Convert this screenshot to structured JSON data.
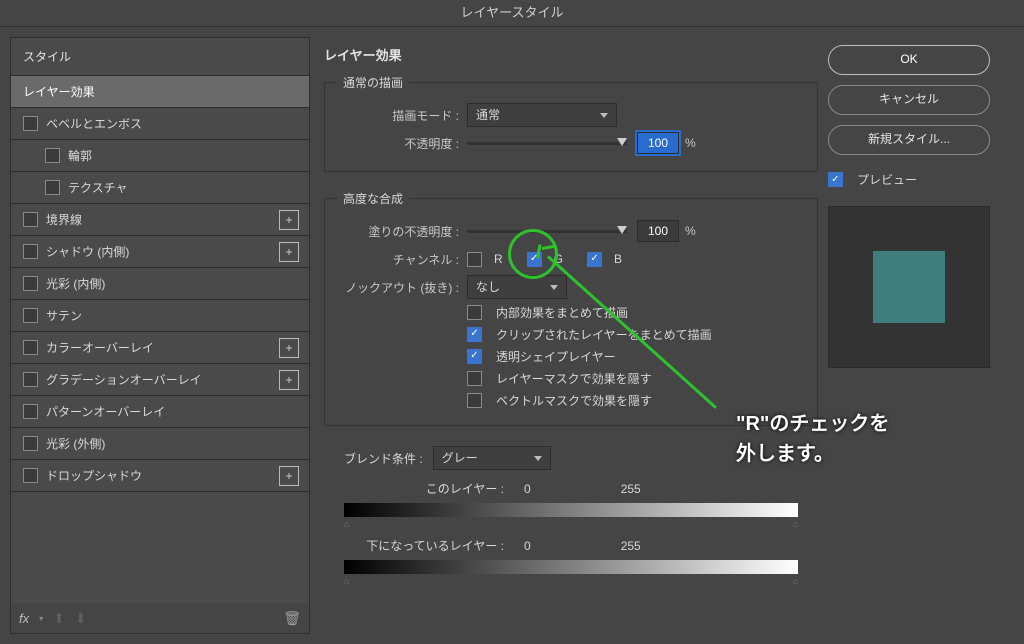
{
  "window": {
    "title": "レイヤースタイル"
  },
  "sidebar": {
    "header": "スタイル",
    "items": [
      {
        "label": "レイヤー効果",
        "selected": true,
        "check": false,
        "sub": false,
        "add": false
      },
      {
        "label": "ベベルとエンボス",
        "selected": false,
        "check": true,
        "checked": false,
        "sub": false,
        "add": false
      },
      {
        "label": "輪郭",
        "selected": false,
        "check": true,
        "checked": false,
        "sub": true,
        "add": false
      },
      {
        "label": "テクスチャ",
        "selected": false,
        "check": true,
        "checked": false,
        "sub": true,
        "add": false
      },
      {
        "label": "境界線",
        "selected": false,
        "check": true,
        "checked": false,
        "sub": false,
        "add": true
      },
      {
        "label": "シャドウ (内側)",
        "selected": false,
        "check": true,
        "checked": false,
        "sub": false,
        "add": true
      },
      {
        "label": "光彩 (内側)",
        "selected": false,
        "check": true,
        "checked": false,
        "sub": false,
        "add": false
      },
      {
        "label": "サテン",
        "selected": false,
        "check": true,
        "checked": false,
        "sub": false,
        "add": false
      },
      {
        "label": "カラーオーバーレイ",
        "selected": false,
        "check": true,
        "checked": false,
        "sub": false,
        "add": true
      },
      {
        "label": "グラデーションオーバーレイ",
        "selected": false,
        "check": true,
        "checked": false,
        "sub": false,
        "add": true
      },
      {
        "label": "パターンオーバーレイ",
        "selected": false,
        "check": true,
        "checked": false,
        "sub": false,
        "add": false
      },
      {
        "label": "光彩 (外側)",
        "selected": false,
        "check": true,
        "checked": false,
        "sub": false,
        "add": false
      },
      {
        "label": "ドロップシャドウ",
        "selected": false,
        "check": true,
        "checked": false,
        "sub": false,
        "add": true
      }
    ],
    "toolbar": {
      "fx_label": "fx"
    }
  },
  "main": {
    "title": "レイヤー効果",
    "normal_group": {
      "legend": "通常の描画",
      "blend_mode_label": "描画モード :",
      "blend_mode_value": "通常",
      "opacity_label": "不透明度 :",
      "opacity_value": "100",
      "opacity_unit": "%"
    },
    "advanced_group": {
      "legend": "高度な合成",
      "fill_label": "塗りの不透明度 :",
      "fill_value": "100",
      "fill_unit": "%",
      "channels_label": "チャンネル :",
      "channel_r": "R",
      "channel_g": "G",
      "channel_b": "B",
      "channel_r_checked": false,
      "channel_g_checked": true,
      "channel_b_checked": true,
      "knockout_label": "ノックアウト (抜き) :",
      "knockout_value": "なし",
      "opts": [
        {
          "label": "内部効果をまとめて描画",
          "checked": false
        },
        {
          "label": "クリップされたレイヤーをまとめて描画",
          "checked": true
        },
        {
          "label": "透明シェイプレイヤー",
          "checked": true
        },
        {
          "label": "レイヤーマスクで効果を隠す",
          "checked": false
        },
        {
          "label": "ベクトルマスクで効果を隠す",
          "checked": false
        }
      ]
    },
    "blendif": {
      "label": "ブレンド条件 :",
      "value": "グレー",
      "this_layer": "このレイヤー :",
      "this_lo": "0",
      "this_hi": "255",
      "under_layer": "下になっているレイヤー :",
      "under_lo": "0",
      "under_hi": "255"
    }
  },
  "right": {
    "ok": "OK",
    "cancel": "キャンセル",
    "newstyle": "新規スタイル...",
    "preview": "プレビュー",
    "swatch_color": "#3e7e7d"
  },
  "annotation": {
    "text": "\"R\"のチェックを\n外します。"
  }
}
